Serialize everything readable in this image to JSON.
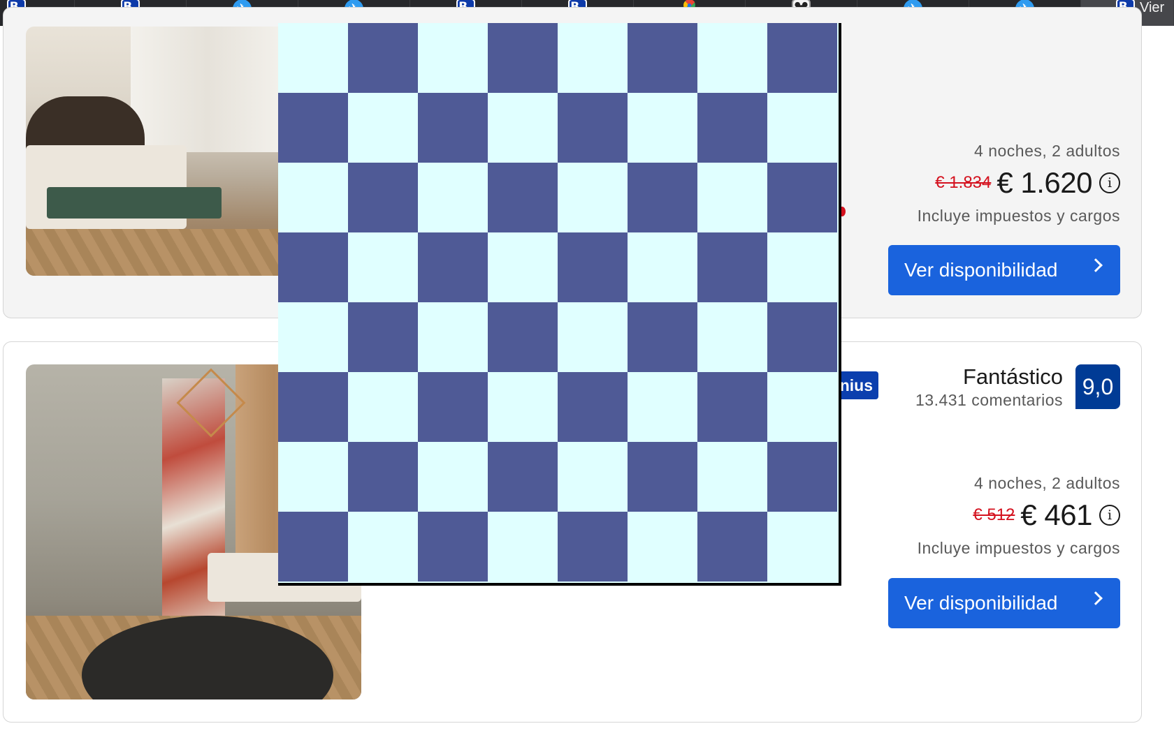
{
  "tabs": [
    {
      "icon": "booking-icon",
      "label": "B."
    },
    {
      "icon": "booking-icon",
      "label": "B."
    },
    {
      "icon": "plane-icon",
      "label": "✈"
    },
    {
      "icon": "plane-icon",
      "label": "✈"
    },
    {
      "icon": "booking-icon",
      "label": "B."
    },
    {
      "icon": "booking-icon",
      "label": "B."
    },
    {
      "icon": "google-maps-icon",
      "label": ""
    },
    {
      "icon": "mickey-icon",
      "label": ""
    },
    {
      "icon": "plane-icon",
      "label": "✈"
    },
    {
      "icon": "plane-icon",
      "label": "✈"
    },
    {
      "icon": "booking-icon",
      "label": "B.",
      "title": "Vier"
    }
  ],
  "listings": [
    {
      "nights": "4 noches, 2 adultos",
      "old_price": "€ 1.834",
      "price": "€ 1.620",
      "taxes": "Incluye impuestos y cargos",
      "cta": "Ver disponibilidad"
    },
    {
      "genius_label": "nius",
      "rating_word": "Fantástico",
      "rating_count": "13.431 comentarios",
      "score": "9,0",
      "nights": "4 noches, 2 adultos",
      "old_price": "€ 512",
      "price": "€ 461",
      "taxes": "Incluye impuestos y cargos",
      "cta": "Ver disponibilidad"
    }
  ],
  "info_icon": "i",
  "overlay": {
    "rows": 8,
    "cols": 8,
    "dark_color": "#4f5a96",
    "light_color": "#e0ffff"
  },
  "colors": {
    "accent": "#1a63dd",
    "score_bg": "#003b95",
    "old_price": "#d4111e"
  }
}
